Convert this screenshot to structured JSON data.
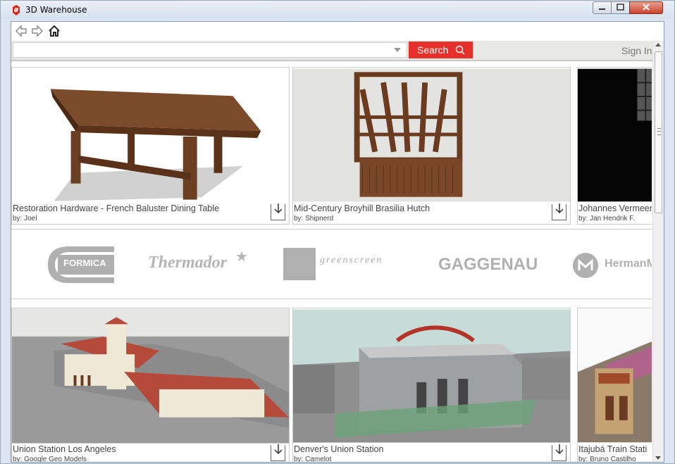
{
  "window": {
    "title": "3D Warehouse"
  },
  "search": {
    "placeholder": "",
    "button_label": "Search",
    "signin_label": "Sign In"
  },
  "models_row1": [
    {
      "name": "Restoration Hardware - French Baluster Dining Table",
      "author": "by: Joel"
    },
    {
      "name": "Mid-Century Broyhill Brasilia Hutch",
      "author": "by: Shipnerd"
    },
    {
      "name": "Johannes Vermeer",
      "author": "by: Jan Hendrik F."
    }
  ],
  "brands": [
    {
      "name": "FORMICA"
    },
    {
      "name": "Thermador"
    },
    {
      "name": "greenscreen"
    },
    {
      "name": "GAGGENAU"
    },
    {
      "name": "HermanM"
    }
  ],
  "models_row2": [
    {
      "name": "Union Station Los Angeles",
      "author": "by: Google Geo Models"
    },
    {
      "name": "Denver's Union Station",
      "author": "by: Camelot"
    },
    {
      "name": "Itajubá Train Stati",
      "author": "by: Bruno Castilho"
    }
  ],
  "colors": {
    "accent": "#e7302a",
    "titlebar": "#dce6f2"
  }
}
